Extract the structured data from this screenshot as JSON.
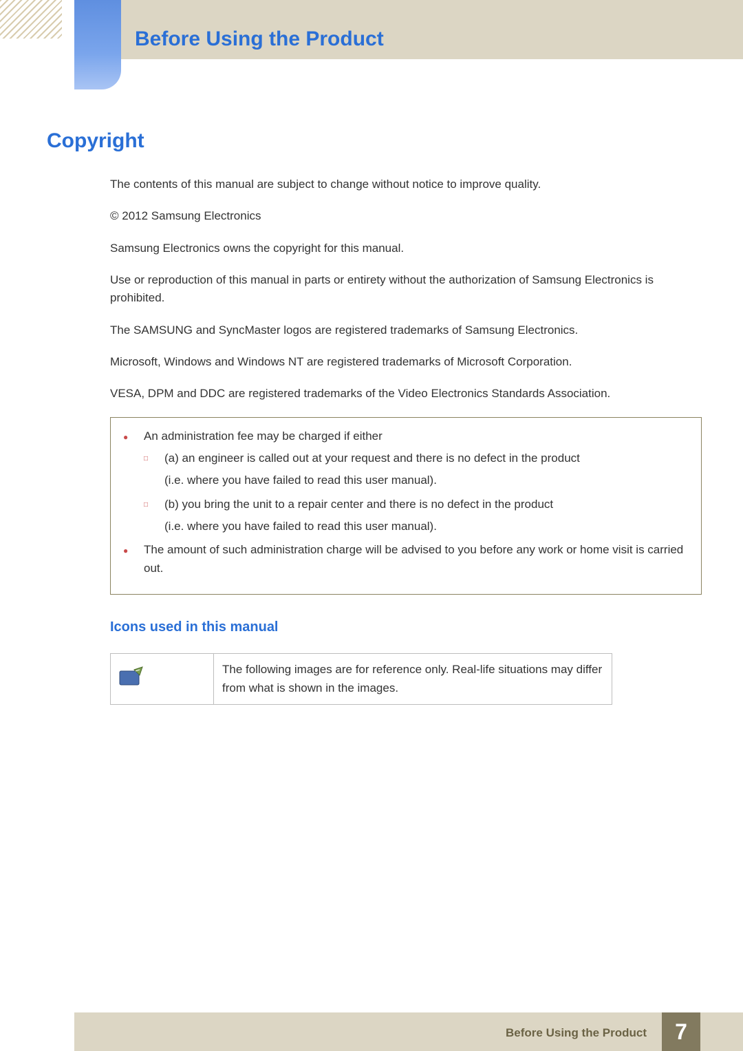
{
  "header": {
    "chapter_title": "Before Using the Product"
  },
  "section": {
    "title": "Copyright",
    "paragraphs": [
      "The contents of this manual are subject to change without notice to improve quality.",
      "© 2012 Samsung Electronics",
      "Samsung Electronics owns the copyright for this manual.",
      "Use or reproduction of this manual in parts or entirety without the authorization of Samsung Electronics is prohibited.",
      "The SAMSUNG and SyncMaster logos are registered trademarks of Samsung Electronics.",
      "Microsoft, Windows and Windows NT are registered trademarks of Microsoft Corporation.",
      "VESA, DPM and DDC are registered trademarks of the Video Electronics Standards Association."
    ],
    "note_box": {
      "bullet1": "An administration fee may be charged if either",
      "sub_a": "(a) an engineer is called out at your request and there is no defect in the product",
      "sub_a2": "(i.e. where you have failed to read this user manual).",
      "sub_b": "(b) you bring the unit to a repair center and there is no defect in the product",
      "sub_b2": "(i.e. where you have failed to read this user manual).",
      "bullet2": "The amount of such administration charge will be advised to you before any work or home visit is carried out."
    },
    "subsection": {
      "title": "Icons used in this manual",
      "icon_desc": "The following images are for reference only. Real-life situations may differ from what is shown in the images."
    }
  },
  "footer": {
    "chapter_label": "Before Using the Product",
    "page_number": "7"
  }
}
